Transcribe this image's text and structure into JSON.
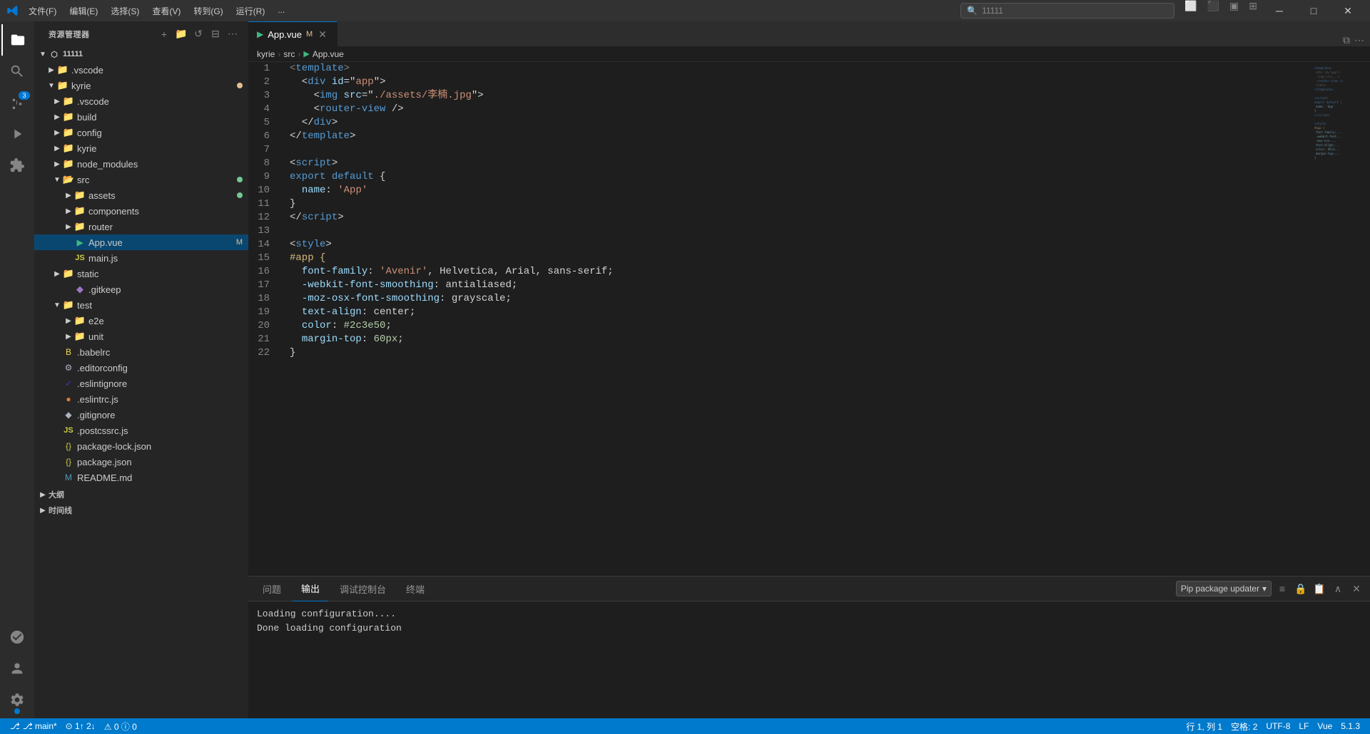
{
  "titlebar": {
    "menus": [
      "文件(F)",
      "编辑(E)",
      "选择(S)",
      "查看(V)",
      "转到(G)",
      "运行(R)",
      "..."
    ],
    "search_placeholder": "11111",
    "controls": [
      "⊟",
      "⧠",
      "✕"
    ]
  },
  "activity_bar": {
    "icons": [
      {
        "name": "explorer-icon",
        "symbol": "⎘",
        "active": true
      },
      {
        "name": "search-icon",
        "symbol": "🔍",
        "active": false
      },
      {
        "name": "source-control-icon",
        "symbol": "⑂",
        "active": false,
        "badge": "3"
      },
      {
        "name": "run-icon",
        "symbol": "▶",
        "active": false
      },
      {
        "name": "extensions-icon",
        "symbol": "⊞",
        "active": false
      }
    ],
    "bottom_icons": [
      {
        "name": "remote-icon",
        "symbol": "⚙",
        "active": false
      },
      {
        "name": "account-icon",
        "symbol": "👤",
        "active": false
      }
    ]
  },
  "sidebar": {
    "title": "资源管理器",
    "actions": [
      "new-file",
      "new-folder",
      "refresh",
      "collapse"
    ],
    "root": "11111",
    "tree": [
      {
        "id": "vscode-root",
        "label": ".vscode",
        "indent": 1,
        "type": "folder",
        "arrow": "▶",
        "collapsed": true
      },
      {
        "id": "kyrie-folder",
        "label": "kyrie",
        "indent": 1,
        "type": "folder",
        "arrow": "▼",
        "collapsed": false,
        "badge": "yellow"
      },
      {
        "id": "vscode-kyrie",
        "label": ".vscode",
        "indent": 2,
        "type": "folder",
        "arrow": "▶",
        "collapsed": true
      },
      {
        "id": "build-folder",
        "label": "build",
        "indent": 2,
        "type": "folder",
        "arrow": "▶",
        "collapsed": true
      },
      {
        "id": "config-folder",
        "label": "config",
        "indent": 2,
        "type": "folder",
        "arrow": "▶",
        "collapsed": true
      },
      {
        "id": "kyrie-sub",
        "label": "kyrie",
        "indent": 2,
        "type": "folder",
        "arrow": "▶",
        "collapsed": true
      },
      {
        "id": "node-modules",
        "label": "node_modules",
        "indent": 2,
        "type": "folder",
        "arrow": "▶",
        "collapsed": true
      },
      {
        "id": "src-folder",
        "label": "src",
        "indent": 2,
        "type": "folder-src",
        "arrow": "▼",
        "collapsed": false,
        "badge": "green"
      },
      {
        "id": "assets-folder",
        "label": "assets",
        "indent": 3,
        "type": "folder",
        "arrow": "▶",
        "collapsed": true,
        "badge": "green"
      },
      {
        "id": "components-folder",
        "label": "components",
        "indent": 3,
        "type": "folder",
        "arrow": "▶",
        "collapsed": true
      },
      {
        "id": "router-folder",
        "label": "router",
        "indent": 3,
        "type": "folder",
        "arrow": "▶",
        "collapsed": true
      },
      {
        "id": "app-vue",
        "label": "App.vue",
        "indent": 3,
        "type": "vue",
        "arrow": "",
        "selected": true,
        "modified": "M"
      },
      {
        "id": "main-js",
        "label": "main.js",
        "indent": 3,
        "type": "js",
        "arrow": ""
      },
      {
        "id": "static-folder",
        "label": "static",
        "indent": 2,
        "type": "folder",
        "arrow": "▶",
        "collapsed": true
      },
      {
        "id": "gitkeep",
        "label": ".gitkeep",
        "indent": 3,
        "type": "diamond",
        "arrow": ""
      },
      {
        "id": "test-folder",
        "label": "test",
        "indent": 2,
        "type": "folder",
        "arrow": "▼",
        "collapsed": false
      },
      {
        "id": "e2e-folder",
        "label": "e2e",
        "indent": 3,
        "type": "folder",
        "arrow": "▶",
        "collapsed": true
      },
      {
        "id": "unit-folder",
        "label": "unit",
        "indent": 3,
        "type": "folder",
        "arrow": "▶",
        "collapsed": true
      },
      {
        "id": "babelrc",
        "label": ".babelrc",
        "indent": 2,
        "type": "babel",
        "arrow": ""
      },
      {
        "id": "editorconfig",
        "label": ".editorconfig",
        "indent": 2,
        "type": "config",
        "arrow": ""
      },
      {
        "id": "eslintignore",
        "label": ".eslintignore",
        "indent": 2,
        "type": "eslint",
        "arrow": ""
      },
      {
        "id": "eslintrc",
        "label": ".eslintrc.js",
        "indent": 2,
        "type": "eslint-circle",
        "arrow": ""
      },
      {
        "id": "gitignore",
        "label": ".gitignore",
        "indent": 2,
        "type": "git",
        "arrow": ""
      },
      {
        "id": "postcssrc",
        "label": ".postcssrc.js",
        "indent": 2,
        "type": "js",
        "arrow": ""
      },
      {
        "id": "package-lock",
        "label": "package-lock.json",
        "indent": 2,
        "type": "json-lock",
        "arrow": ""
      },
      {
        "id": "package-json",
        "label": "package.json",
        "indent": 2,
        "type": "json",
        "arrow": ""
      },
      {
        "id": "readme",
        "label": "README.md",
        "indent": 2,
        "type": "md",
        "arrow": ""
      }
    ],
    "extra_sections": [
      {
        "label": "大纲",
        "indent": 0
      },
      {
        "label": "时间线",
        "indent": 0
      }
    ]
  },
  "editor": {
    "tabs": [
      {
        "label": "App.vue",
        "type": "vue",
        "active": true,
        "modified": true
      }
    ],
    "breadcrumb": [
      "kyrie",
      "src",
      "App.vue"
    ],
    "filename": "App.vue",
    "lines": [
      {
        "num": 1,
        "tokens": [
          {
            "t": "<",
            "c": "syn-tag"
          },
          {
            "t": "template",
            "c": "syn-tagname"
          },
          {
            "t": ">",
            "c": "syn-tag"
          }
        ]
      },
      {
        "num": 2,
        "tokens": [
          {
            "t": "  <",
            "c": "syn-tag"
          },
          {
            "t": "div",
            "c": "syn-tagname"
          },
          {
            "t": " ",
            "c": "syn-text"
          },
          {
            "t": "id",
            "c": "syn-attr"
          },
          {
            "t": "=\"",
            "c": "syn-text"
          },
          {
            "t": "app",
            "c": "syn-string"
          },
          {
            "t": "\">",
            "c": "syn-text"
          }
        ]
      },
      {
        "num": 3,
        "tokens": [
          {
            "t": "    <",
            "c": "syn-tag"
          },
          {
            "t": "img",
            "c": "syn-tagname"
          },
          {
            "t": " ",
            "c": "syn-text"
          },
          {
            "t": "src",
            "c": "syn-attr"
          },
          {
            "t": "=\"",
            "c": "syn-text"
          },
          {
            "t": "./assets/李楠.jpg",
            "c": "syn-string"
          },
          {
            "t": "\">",
            "c": "syn-text"
          }
        ]
      },
      {
        "num": 4,
        "tokens": [
          {
            "t": "    <",
            "c": "syn-tag"
          },
          {
            "t": "router-view",
            "c": "syn-tagname"
          },
          {
            "t": " />",
            "c": "syn-tag"
          }
        ]
      },
      {
        "num": 5,
        "tokens": [
          {
            "t": "  </",
            "c": "syn-tag"
          },
          {
            "t": "div",
            "c": "syn-tagname"
          },
          {
            "t": ">",
            "c": "syn-tag"
          }
        ]
      },
      {
        "num": 6,
        "tokens": [
          {
            "t": "</",
            "c": "syn-tag"
          },
          {
            "t": "template",
            "c": "syn-tagname"
          },
          {
            "t": ">",
            "c": "syn-tag"
          }
        ]
      },
      {
        "num": 7,
        "tokens": []
      },
      {
        "num": 8,
        "tokens": [
          {
            "t": "<",
            "c": "syn-tag"
          },
          {
            "t": "script",
            "c": "syn-tagname"
          },
          {
            "t": ">",
            "c": "syn-tag"
          }
        ]
      },
      {
        "num": 9,
        "tokens": [
          {
            "t": "export ",
            "c": "syn-keyword"
          },
          {
            "t": "default",
            "c": "syn-keyword"
          },
          {
            "t": " {",
            "c": "syn-text"
          }
        ]
      },
      {
        "num": 10,
        "tokens": [
          {
            "t": "  ",
            "c": "syn-text"
          },
          {
            "t": "name",
            "c": "syn-prop"
          },
          {
            "t": ": ",
            "c": "syn-text"
          },
          {
            "t": "'App'",
            "c": "syn-string"
          }
        ]
      },
      {
        "num": 11,
        "tokens": [
          {
            "t": "}",
            "c": "syn-text"
          }
        ]
      },
      {
        "num": 12,
        "tokens": [
          {
            "t": "</",
            "c": "syn-tag"
          },
          {
            "t": "script",
            "c": "syn-tagname"
          },
          {
            "t": ">",
            "c": "syn-tag"
          }
        ]
      },
      {
        "num": 13,
        "tokens": []
      },
      {
        "num": 14,
        "tokens": [
          {
            "t": "<",
            "c": "syn-tag"
          },
          {
            "t": "style",
            "c": "syn-tagname"
          },
          {
            "t": ">",
            "c": "syn-tag"
          }
        ]
      },
      {
        "num": 15,
        "tokens": [
          {
            "t": "#app {",
            "c": "syn-selector"
          }
        ]
      },
      {
        "num": 16,
        "tokens": [
          {
            "t": "  ",
            "c": "syn-text"
          },
          {
            "t": "font-family",
            "c": "syn-prop"
          },
          {
            "t": ": ",
            "c": "syn-text"
          },
          {
            "t": "'Avenir'",
            "c": "syn-string"
          },
          {
            "t": ", Helvetica, Arial, sans-serif;",
            "c": "syn-text"
          }
        ]
      },
      {
        "num": 17,
        "tokens": [
          {
            "t": "  ",
            "c": "syn-text"
          },
          {
            "t": "-webkit-font-smoothing",
            "c": "syn-prop"
          },
          {
            "t": ": antialiased;",
            "c": "syn-text"
          }
        ]
      },
      {
        "num": 18,
        "tokens": [
          {
            "t": "  ",
            "c": "syn-text"
          },
          {
            "t": "-moz-osx-font-smoothing",
            "c": "syn-prop"
          },
          {
            "t": ": grayscale;",
            "c": "syn-text"
          }
        ]
      },
      {
        "num": 19,
        "tokens": [
          {
            "t": "  ",
            "c": "syn-text"
          },
          {
            "t": "text-align",
            "c": "syn-prop"
          },
          {
            "t": ": center;",
            "c": "syn-text"
          }
        ]
      },
      {
        "num": 20,
        "tokens": [
          {
            "t": "  ",
            "c": "syn-text"
          },
          {
            "t": "color",
            "c": "syn-prop"
          },
          {
            "t": ": ",
            "c": "syn-text"
          },
          {
            "t": "#2c3e50",
            "c": "syn-number"
          },
          {
            "t": ";",
            "c": "syn-text"
          }
        ]
      },
      {
        "num": 21,
        "tokens": [
          {
            "t": "  ",
            "c": "syn-text"
          },
          {
            "t": "margin-top",
            "c": "syn-prop"
          },
          {
            "t": ": ",
            "c": "syn-text"
          },
          {
            "t": "60px",
            "c": "syn-number"
          },
          {
            "t": ";",
            "c": "syn-text"
          }
        ]
      },
      {
        "num": 22,
        "tokens": [
          {
            "t": "}",
            "c": "syn-text"
          }
        ]
      }
    ]
  },
  "panel": {
    "tabs": [
      "问题",
      "输出",
      "调试控制台",
      "终端"
    ],
    "active_tab": "输出",
    "dropdown_label": "Pip package updater",
    "lines": [
      "Loading configuration....",
      "Done loading configuration"
    ]
  },
  "statusbar": {
    "left": [
      {
        "label": "⎇ main*",
        "name": "branch"
      },
      {
        "label": "⊙ 1↑ 2↓",
        "name": "sync"
      },
      {
        "label": "⚠ 0  ⓘ 0",
        "name": "problems"
      }
    ],
    "right": [
      {
        "label": "行 1, 列 1",
        "name": "cursor-position"
      },
      {
        "label": "空格: 2",
        "name": "indent"
      },
      {
        "label": "UTF-8",
        "name": "encoding"
      },
      {
        "label": "LF",
        "name": "line-ending"
      },
      {
        "label": "Vue",
        "name": "language"
      },
      {
        "label": "5.1.3",
        "name": "version"
      }
    ]
  }
}
